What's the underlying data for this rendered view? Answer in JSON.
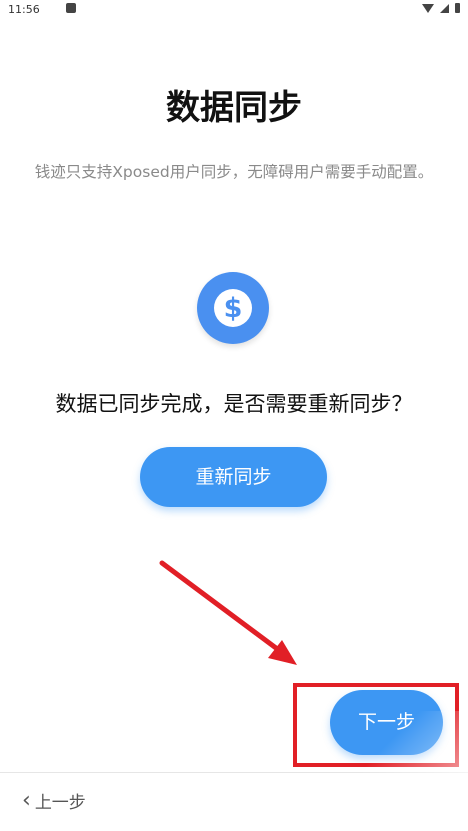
{
  "status_bar": {
    "time": "11:56"
  },
  "page": {
    "title": "数据同步",
    "subtitle": "钱迹只支持Xposed用户同步，无障碍用户需要手动配置。",
    "question": "数据已同步完成，是否需要重新同步？"
  },
  "buttons": {
    "resync_label": "重新同步",
    "next_label": "下一步",
    "prev_label": "上一步"
  },
  "icons": {
    "coin": "dollar-coin-icon",
    "back": "chevron-left-icon"
  },
  "colors": {
    "accent": "#3d97f3",
    "annotation": "#e11f26"
  }
}
